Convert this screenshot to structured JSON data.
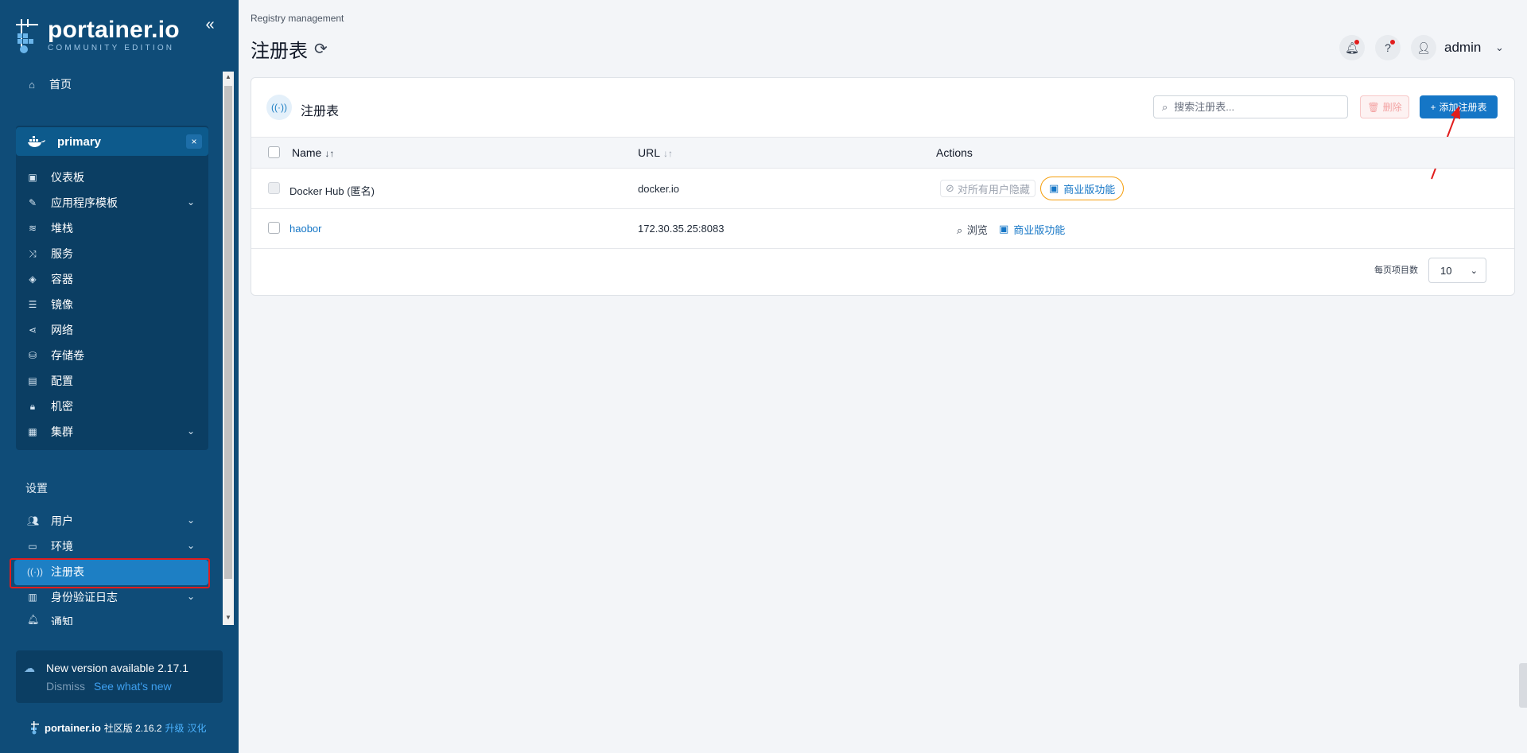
{
  "app": {
    "logo_text": "portainer.io",
    "logo_sub": "COMMUNITY EDITION"
  },
  "sidebar": {
    "home": "首页",
    "environment": {
      "name": "primary",
      "items": [
        {
          "label": "仪表板",
          "icon": "dashboard-icon"
        },
        {
          "label": "应用程序模板",
          "icon": "edit-icon",
          "expandable": true
        },
        {
          "label": "堆栈",
          "icon": "layers-icon"
        },
        {
          "label": "服务",
          "icon": "shuffle-icon"
        },
        {
          "label": "容器",
          "icon": "box-icon"
        },
        {
          "label": "镜像",
          "icon": "list-icon"
        },
        {
          "label": "网络",
          "icon": "share-icon"
        },
        {
          "label": "存储卷",
          "icon": "database-icon"
        },
        {
          "label": "配置",
          "icon": "clipboard-icon"
        },
        {
          "label": "机密",
          "icon": "lock-icon"
        },
        {
          "label": "集群",
          "icon": "cluster-icon",
          "expandable": true
        }
      ]
    },
    "settings_title": "设置",
    "settings_items": [
      {
        "label": "用户",
        "icon": "users-icon",
        "expandable": true
      },
      {
        "label": "环境",
        "icon": "hdd-icon",
        "expandable": true
      },
      {
        "label": "注册表",
        "icon": "radio-icon",
        "active": true
      },
      {
        "label": "身份验证日志",
        "icon": "file-icon",
        "expandable": true
      },
      {
        "label": "通知",
        "icon": "bell-icon"
      }
    ],
    "update": {
      "title": "New version available 2.17.1",
      "dismiss": "Dismiss",
      "see_new": "See what's new"
    },
    "footer": {
      "brand": "portainer.io",
      "version": "社区版 2.16.2",
      "upgrade": "升级",
      "localize": "汉化"
    }
  },
  "header": {
    "breadcrumb": "Registry management",
    "title": "注册表",
    "user": "admin"
  },
  "panel": {
    "title": "注册表",
    "search_placeholder": "搜索注册表...",
    "delete_label": "删除",
    "add_label": "添加注册表",
    "columns": {
      "name": "Name",
      "url": "URL",
      "actions": "Actions"
    },
    "rows": [
      {
        "name": "Docker Hub (匿名)",
        "url": "docker.io",
        "hide_label": "对所有用户隐藏",
        "biz_label": "商业版功能"
      },
      {
        "name": "haobor",
        "url": "172.30.35.25:8083",
        "browse_label": "浏览",
        "biz_label": "商业版功能"
      }
    ],
    "per_page_label": "每页项目数",
    "per_page_value": "10"
  },
  "colors": {
    "sidebar_bg": "#0f4c78",
    "accent": "#1576c6",
    "active_item": "#1d7fc4",
    "highlight_border": "#e11d1d"
  }
}
